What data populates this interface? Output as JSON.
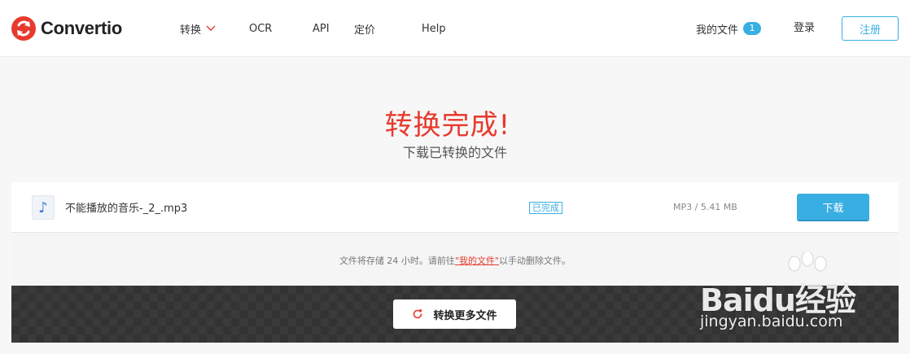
{
  "app": {
    "logo_text": "Convertio",
    "accent_color": "#e83a2f",
    "primary_color": "#39aee3"
  },
  "nav": {
    "items": [
      {
        "label": "转换",
        "has_dropdown": true
      },
      {
        "label": "OCR"
      },
      {
        "label": "API"
      },
      {
        "label": "定价"
      },
      {
        "label": "Help"
      }
    ],
    "my_files_label": "我的文件",
    "my_files_count": "1",
    "login_label": "登录",
    "signup_label": "注册"
  },
  "hero": {
    "title": "转换完成!",
    "subtitle": "下载已转换的文件"
  },
  "file": {
    "icon": "music-note-icon",
    "name": "不能播放的音乐-_2_.mp3",
    "status": "已完成",
    "meta": "MP3 / 5.41 MB",
    "download_label": "下载"
  },
  "note": {
    "before": "文件将存储 24 小时。请前往",
    "link": "\"我的文件\"",
    "after": "以手动删除文件。"
  },
  "more": {
    "label": "转换更多文件"
  },
  "watermark": {
    "brand": "Baidu经验",
    "url": "jingyan.baidu.com"
  }
}
